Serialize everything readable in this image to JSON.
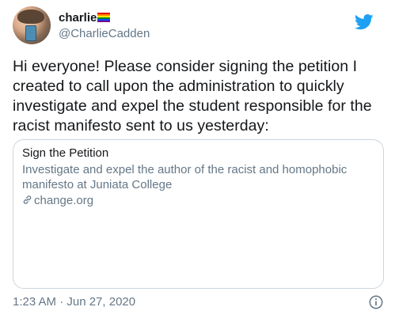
{
  "author": {
    "display_name": "charlie",
    "flag_icon": "rainbow-flag-icon",
    "handle": "@CharlieCadden"
  },
  "brand": {
    "logo": "twitter-bird-icon",
    "color": "#1da1f2"
  },
  "tweet": {
    "text": "Hi everyone! Please consider signing the petition I created to call upon the administration to quickly investigate and expel the student responsible for the racist manifesto sent to us yesterday:",
    "timestamp": "1:23 AM · Jun 27, 2020"
  },
  "card": {
    "title": "Sign the Petition",
    "description": "Investigate and expel the author of the racist and homophobic manifesto at Juniata College",
    "link_icon": "link-icon",
    "domain": "change.org"
  },
  "colors": {
    "text_primary": "#14171a",
    "text_secondary": "#657786",
    "border": "#ccd6dd"
  },
  "info_icon": "info-icon"
}
